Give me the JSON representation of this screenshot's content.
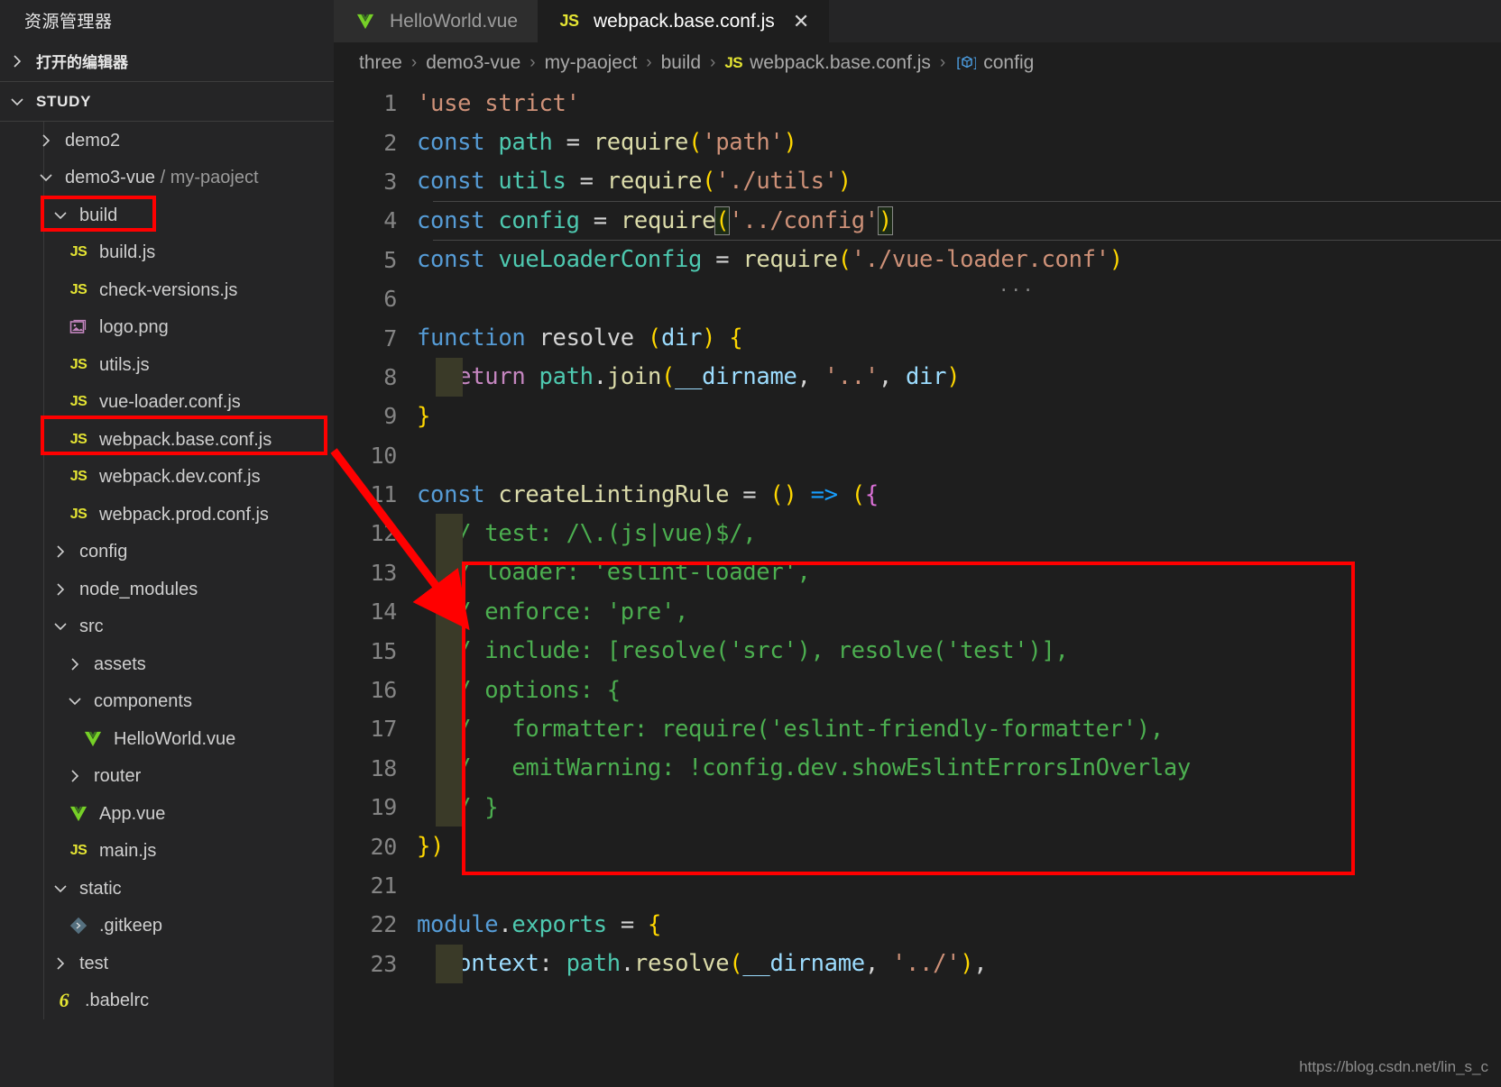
{
  "sidebar": {
    "explorer_title": "资源管理器",
    "open_editors_label": "打开的编辑器",
    "workspace_label": "STUDY",
    "tree": [
      {
        "label": "demo2",
        "indent": 1,
        "type": "folder",
        "expanded": false
      },
      {
        "label": "demo3-vue",
        "sublabel": "/ my-paoject",
        "indent": 1,
        "type": "folder",
        "expanded": true
      },
      {
        "label": "build",
        "indent": 2,
        "type": "folder",
        "expanded": true,
        "highlighted": true
      },
      {
        "label": "build.js",
        "indent": 3,
        "type": "js"
      },
      {
        "label": "check-versions.js",
        "indent": 3,
        "type": "js"
      },
      {
        "label": "logo.png",
        "indent": 3,
        "type": "image"
      },
      {
        "label": "utils.js",
        "indent": 3,
        "type": "js"
      },
      {
        "label": "vue-loader.conf.js",
        "indent": 3,
        "type": "js"
      },
      {
        "label": "webpack.base.conf.js",
        "indent": 3,
        "type": "js",
        "highlighted": true
      },
      {
        "label": "webpack.dev.conf.js",
        "indent": 3,
        "type": "js"
      },
      {
        "label": "webpack.prod.conf.js",
        "indent": 3,
        "type": "js"
      },
      {
        "label": "config",
        "indent": 2,
        "type": "folder",
        "expanded": false
      },
      {
        "label": "node_modules",
        "indent": 2,
        "type": "folder",
        "expanded": false
      },
      {
        "label": "src",
        "indent": 2,
        "type": "folder",
        "expanded": true
      },
      {
        "label": "assets",
        "indent": 3,
        "type": "folder",
        "expanded": false
      },
      {
        "label": "components",
        "indent": 3,
        "type": "folder",
        "expanded": true
      },
      {
        "label": "HelloWorld.vue",
        "indent": 4,
        "type": "vue"
      },
      {
        "label": "router",
        "indent": 3,
        "type": "folder",
        "expanded": false
      },
      {
        "label": "App.vue",
        "indent": 3,
        "type": "vue"
      },
      {
        "label": "main.js",
        "indent": 3,
        "type": "js"
      },
      {
        "label": "static",
        "indent": 2,
        "type": "folder",
        "expanded": true
      },
      {
        "label": ".gitkeep",
        "indent": 3,
        "type": "git"
      },
      {
        "label": "test",
        "indent": 2,
        "type": "folder",
        "expanded": false
      },
      {
        "label": ".babelrc",
        "indent": 2,
        "type": "babel"
      }
    ]
  },
  "tabs": [
    {
      "label": "HelloWorld.vue",
      "icon": "vue-file-icon",
      "active": false,
      "closable": false
    },
    {
      "label": "webpack.base.conf.js",
      "icon": "js-file-icon",
      "active": true,
      "closable": true,
      "close_glyph": "✕"
    }
  ],
  "breadcrumb": {
    "separator": "›",
    "items": [
      {
        "label": "three"
      },
      {
        "label": "demo3-vue"
      },
      {
        "label": "my-paoject"
      },
      {
        "label": "build"
      },
      {
        "label": "webpack.base.conf.js",
        "icon": "js-file-icon"
      },
      {
        "label": "config",
        "icon": "symbol-variable-icon"
      }
    ]
  },
  "editor": {
    "filename": "webpack.base.conf.js",
    "current_line": 4,
    "lines": [
      {
        "n": 1,
        "text": "'use strict'"
      },
      {
        "n": 2,
        "text": "const path = require('path')"
      },
      {
        "n": 3,
        "text": "const utils = require('./utils')"
      },
      {
        "n": 4,
        "text": "const config = require('../config')"
      },
      {
        "n": 5,
        "text": "const vueLoaderConfig = require('./vue-loader.conf')"
      },
      {
        "n": 6,
        "text": ""
      },
      {
        "n": 7,
        "text": "function resolve (dir) {"
      },
      {
        "n": 8,
        "text": "  return path.join(__dirname, '..', dir)"
      },
      {
        "n": 9,
        "text": "}"
      },
      {
        "n": 10,
        "text": ""
      },
      {
        "n": 11,
        "text": "const createLintingRule = () => ({"
      },
      {
        "n": 12,
        "text": "  // test: /\\.(js|vue)$/,"
      },
      {
        "n": 13,
        "text": "  // loader: 'eslint-loader',"
      },
      {
        "n": 14,
        "text": "  // enforce: 'pre',"
      },
      {
        "n": 15,
        "text": "  // include: [resolve('src'), resolve('test')],"
      },
      {
        "n": 16,
        "text": "  // options: {"
      },
      {
        "n": 17,
        "text": "  //   formatter: require('eslint-friendly-formatter'),"
      },
      {
        "n": 18,
        "text": "  //   emitWarning: !config.dev.showEslintErrorsInOverlay"
      },
      {
        "n": 19,
        "text": "  // }"
      },
      {
        "n": 20,
        "text": "})"
      },
      {
        "n": 21,
        "text": ""
      },
      {
        "n": 22,
        "text": "module.exports = {"
      },
      {
        "n": 23,
        "text": "  context: path.resolve(__dirname, '../'),"
      }
    ]
  },
  "annotations": {
    "highlight_color": "#ff0000",
    "boxes": [
      {
        "name": "build-folder-highlight"
      },
      {
        "name": "webpack-base-conf-file-highlight"
      },
      {
        "name": "commented-lint-rule-block-highlight"
      }
    ],
    "arrow": {
      "name": "pointer-arrow",
      "from": "webpack.base.conf.js",
      "to": "commented lint rule block"
    }
  },
  "watermark": {
    "text": "https://blog.csdn.net/lin_s_c"
  }
}
